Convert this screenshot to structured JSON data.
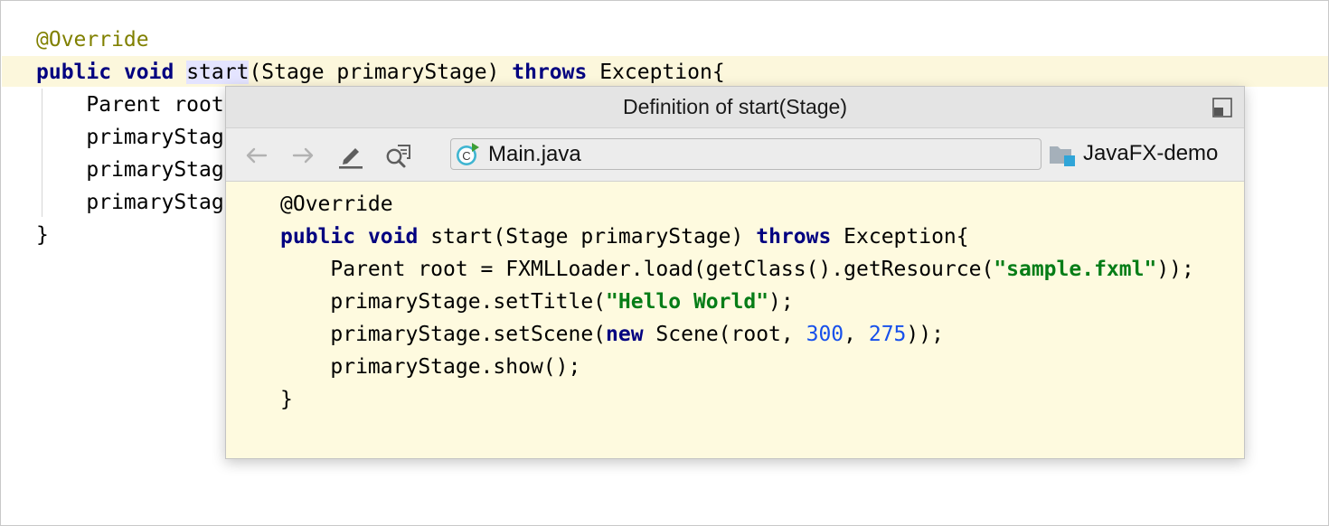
{
  "editor": {
    "lines": [
      {
        "annotation": "@Override"
      },
      {
        "kw1": "public",
        "kw2": "void",
        "method": "start",
        "params": "(Stage primaryStage) ",
        "kw3": "throws",
        "rest": " Exception{"
      },
      {
        "text": "    Parent root"
      },
      {
        "text": "    primaryStag"
      },
      {
        "text": "    primaryStag"
      },
      {
        "text": "    primaryStag"
      },
      {
        "text": "}"
      }
    ]
  },
  "popup": {
    "title": "Definition of start(Stage)",
    "toolbar": {
      "back_icon": "arrow-left-icon",
      "forward_icon": "arrow-right-icon",
      "edit_icon": "pencil-icon",
      "find_usages_icon": "find-usages-icon",
      "file_icon": "java-class-icon",
      "file_name": "Main.java",
      "module_icon": "module-folder-icon",
      "module_name": "JavaFX-demo"
    },
    "restore_icon": "restore-window-icon",
    "code": {
      "l1_annotation": "@Override",
      "l2_kw1": "public",
      "l2_kw2": "void",
      "l2_sig": " start(Stage primaryStage) ",
      "l2_kw3": "throws",
      "l2_rest": " Exception{",
      "l3_pre": "    Parent root = FXMLLoader.load(getClass().getResource(",
      "l3_str": "\"sample.fxml\"",
      "l3_post": "));",
      "l4_pre": "    primaryStage.setTitle(",
      "l4_str": "\"Hello World\"",
      "l4_post": ");",
      "l5_pre": "    primaryStage.setScene(",
      "l5_kw": "new",
      "l5_mid": " Scene(root, ",
      "l5_n1": "300",
      "l5_sep": ", ",
      "l5_n2": "275",
      "l5_post": "));",
      "l6": "    primaryStage.show();",
      "l7": "}"
    }
  },
  "colors": {
    "keyword": "#000080",
    "annotation": "#808000",
    "string": "#067d17",
    "number": "#1750eb",
    "popup_background": "#fefadf",
    "current_line": "#fcf7dc"
  }
}
